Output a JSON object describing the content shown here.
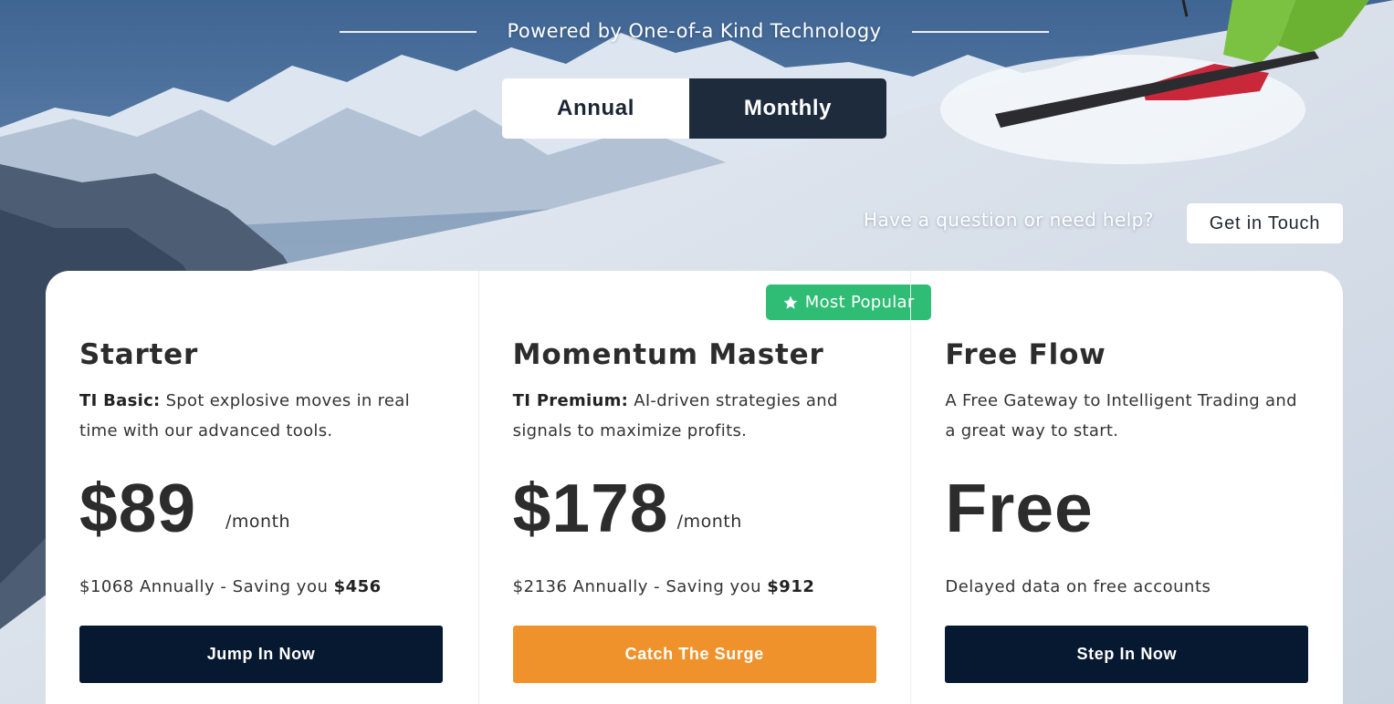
{
  "header": {
    "tagline": "Powered by One-of-a Kind Technology"
  },
  "billing_toggle": {
    "options": [
      {
        "label": "Annual",
        "selected": false
      },
      {
        "label": "Monthly",
        "selected": true
      }
    ]
  },
  "help": {
    "question": "Have a question or need help?",
    "button_label": "Get in Touch"
  },
  "colors": {
    "dark_navy": "#061931",
    "toggle_active": "#1e2b3d",
    "accent_orange": "#f0922b",
    "badge_green": "#2fbc74"
  },
  "plans": [
    {
      "name": "Starter",
      "desc_strong": "TI Basic:",
      "desc_text": " Spot explosive moves in real time with our advanced tools.",
      "price": "$89",
      "period": "/month",
      "note_text": "$1068 Annually - Saving you ",
      "note_strong": "$456",
      "cta_label": "Jump In Now"
    },
    {
      "badge": {
        "icon": "star-icon",
        "label": "Most Popular"
      },
      "name": "Momentum Master",
      "desc_strong": "TI Premium:",
      "desc_text": " AI-driven strategies and signals to maximize profits.",
      "price": "$178",
      "period": "/month",
      "note_text": "$2136 Annually - Saving you ",
      "note_strong": "$912",
      "cta_label": "Catch The Surge"
    },
    {
      "name": "Free Flow",
      "desc_text": "A Free Gateway to Intelligent Trading and a great way to start.",
      "price": "Free",
      "note_text": "Delayed data on free accounts",
      "cta_label": "Step In Now"
    }
  ]
}
